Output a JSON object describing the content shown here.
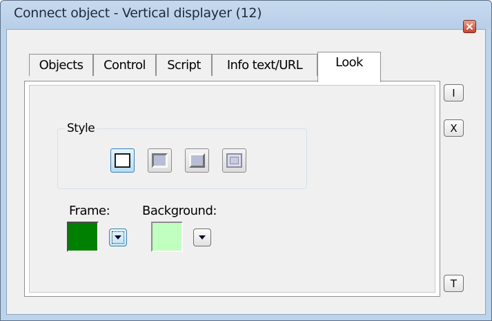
{
  "window": {
    "title": "Connect object - Vertical displayer (12)"
  },
  "tabs": [
    {
      "label": "Objects",
      "active": false
    },
    {
      "label": "Control",
      "active": false
    },
    {
      "label": "Script",
      "active": false
    },
    {
      "label": "Info text/URL",
      "active": false
    },
    {
      "label": "Look",
      "active": true
    }
  ],
  "side_buttons": {
    "top": "I",
    "middle": "X",
    "bottom": "T"
  },
  "style_group": {
    "label": "Style",
    "selected_index": 0
  },
  "frame": {
    "label": "Frame:",
    "color": "#008000"
  },
  "background": {
    "label": "Background:",
    "color": "#c0ffc0"
  },
  "colors": {
    "titlebar": "#bcd3ec",
    "accent": "#3c7fb1"
  }
}
